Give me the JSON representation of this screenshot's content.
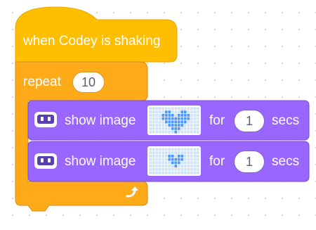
{
  "hat_block": {
    "label": "when Codey is shaking"
  },
  "repeat_block": {
    "label": "repeat",
    "count": "10"
  },
  "stack": [
    {
      "icon": "codey-robot-icon",
      "label": "show image",
      "image": "heart-large",
      "for_label": "for",
      "seconds": "1",
      "secs_label": "secs"
    },
    {
      "icon": "codey-robot-icon",
      "label": "show image",
      "image": "heart-small",
      "for_label": "for",
      "seconds": "1",
      "secs_label": "secs"
    }
  ],
  "colors": {
    "events": "#ffbf00",
    "control": "#ffab19",
    "looks": "#9966ff",
    "heart_pixel": "#4c97ff",
    "pixel_off": "#cfe3f5"
  }
}
